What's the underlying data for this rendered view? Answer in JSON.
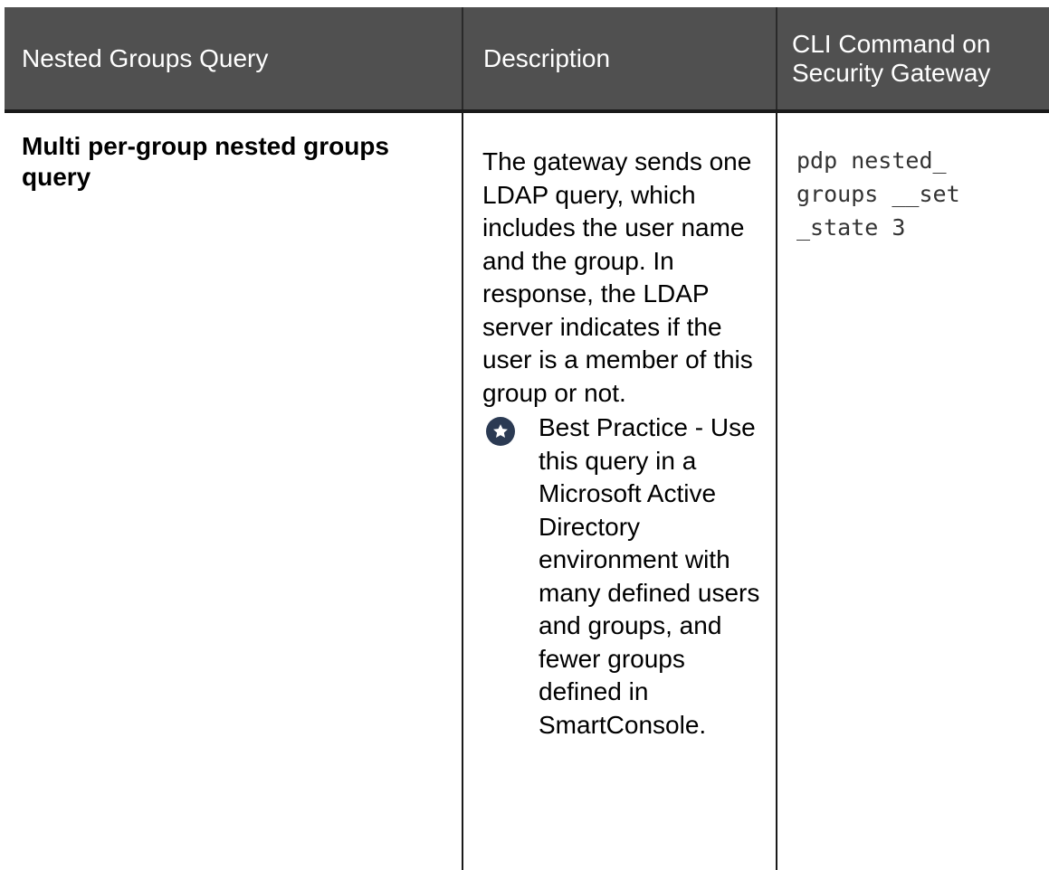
{
  "table": {
    "headers": {
      "query": "Nested Groups Query",
      "description": "Description",
      "cli": "CLI Command on Security Gateway"
    },
    "rows": [
      {
        "query": "Multi per-group nested groups query",
        "description": "The gateway sends one LDAP query, which includes the user name and the group. In response, the LDAP server indicates if the user is a member of this group or not.",
        "best_practice": {
          "icon": "star-icon",
          "title": "Best Practice",
          "separator": " -",
          "text": "Use this query in a Microsoft Active Directory environment with many defined users and groups, and fewer groups defined in SmartConsole."
        },
        "cli": "pdp nested_groups __set_state 3"
      }
    ]
  },
  "colors": {
    "header_bg": "#505050",
    "header_text": "#ffffff",
    "icon_bg": "#2b3a53"
  }
}
